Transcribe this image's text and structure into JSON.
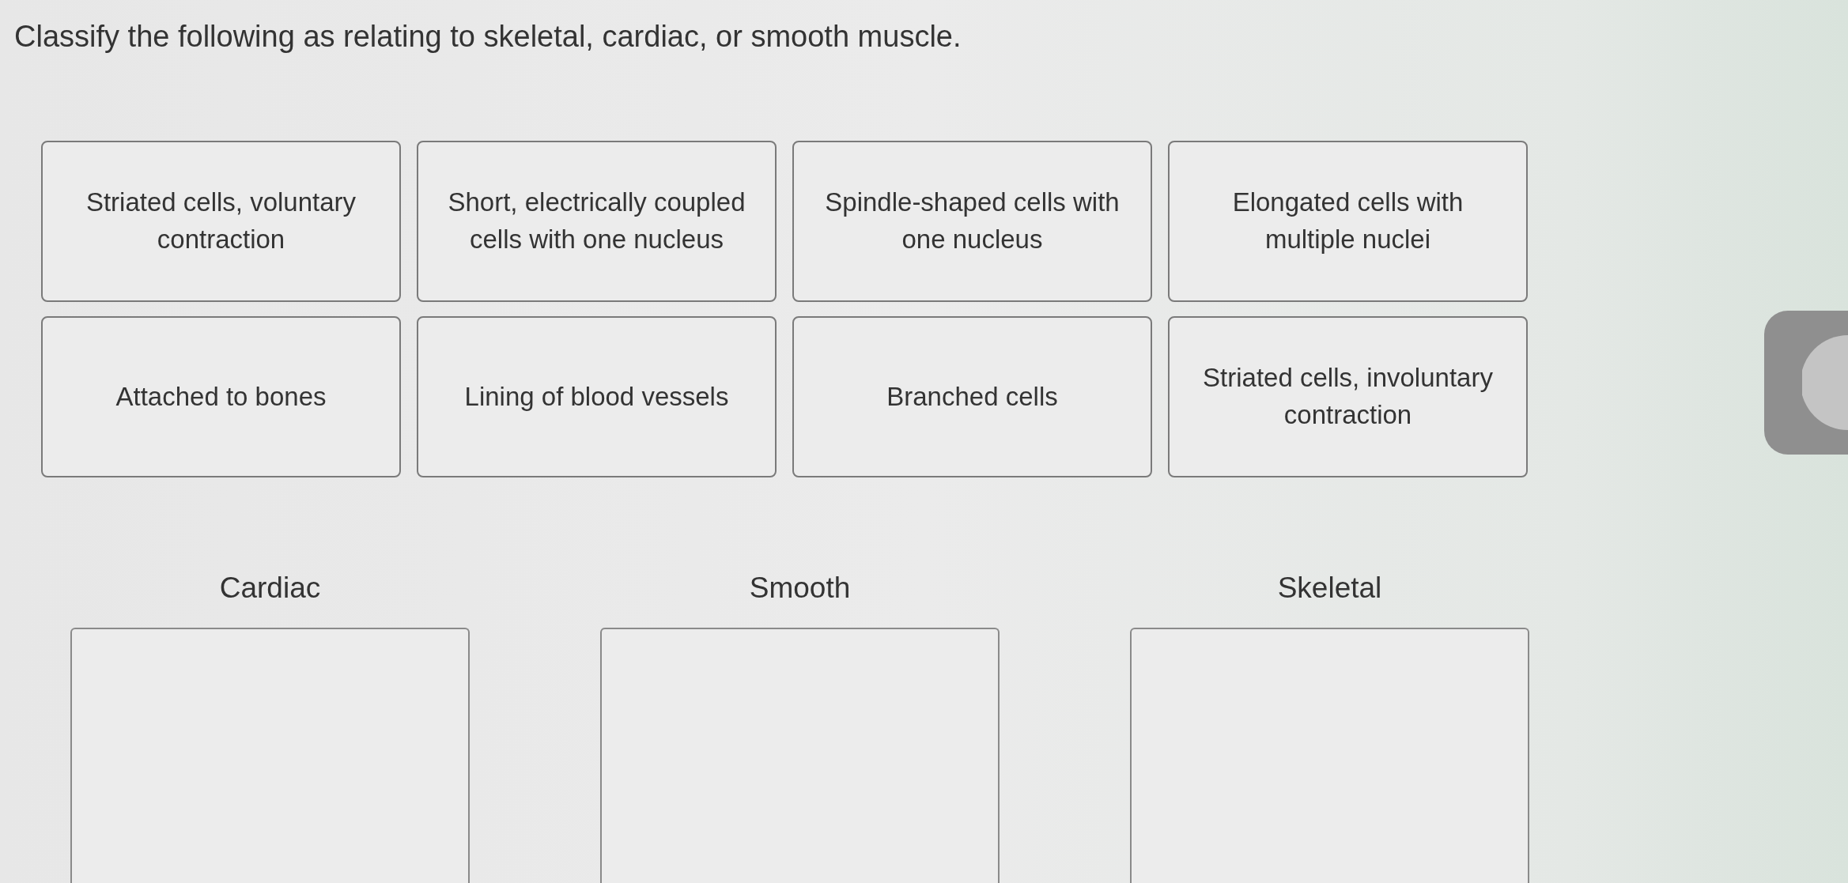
{
  "question": {
    "text": "Classify the following as relating to skeletal, cardiac, or smooth muscle."
  },
  "items": [
    {
      "label": "Striated cells, voluntary contraction"
    },
    {
      "label": "Short, electrically coupled cells with one nucleus"
    },
    {
      "label": "Spindle-shaped cells with one nucleus"
    },
    {
      "label": "Elongated cells with multiple nuclei"
    },
    {
      "label": "Attached to bones"
    },
    {
      "label": "Lining of blood vessels"
    },
    {
      "label": "Branched cells"
    },
    {
      "label": "Striated cells, involuntary contraction"
    }
  ],
  "bins": [
    {
      "label": "Cardiac"
    },
    {
      "label": "Smooth"
    },
    {
      "label": "Skeletal"
    }
  ]
}
